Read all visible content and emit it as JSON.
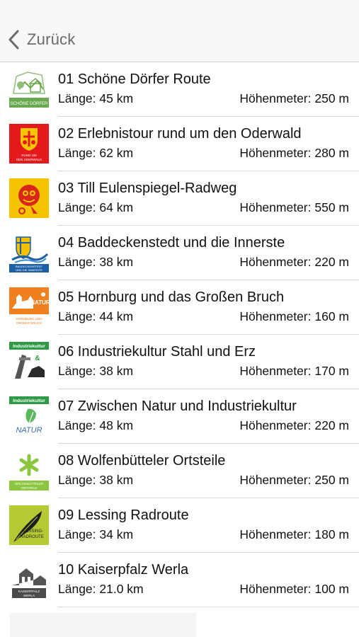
{
  "nav": {
    "back_label": "Zurück",
    "back_icon": "chevron-left-icon",
    "tint": "#6b6b6b"
  },
  "routes": [
    {
      "title": "01 Schöne Dörfer Route",
      "length": "Länge: 45 km",
      "elevation": "Höhenmeter: 250 m",
      "logo_text": "SCHÖNE DÖRFER",
      "logo_color": "#6aa84f"
    },
    {
      "title": "02 Erlebnistour rund um den Oderwald",
      "length": "Länge: 62 km",
      "elevation": "Höhenmeter: 280 m",
      "logo_text": "RUND UM DEN ODERWALD",
      "logo_color": "#e3191b"
    },
    {
      "title": "03 Till Eulenspiegel-Radweg",
      "length": "Länge: 64 km",
      "elevation": "Höhenmeter: 550 m",
      "logo_text": "",
      "logo_color": "#f5c400"
    },
    {
      "title": "04 Baddeckenstedt und die Innerste",
      "length": "Länge: 38 km",
      "elevation": "Höhenmeter: 220 m",
      "logo_text": "BADDECKENSTEDT UND DIE INNERSTE",
      "logo_color": "#1d5fa6"
    },
    {
      "title": "05 Hornburg und das Großen Bruch",
      "length": "Länge: 44 km",
      "elevation": "Höhenmeter: 160 m",
      "logo_text": "HORNBURG UND GROßES BRUCH",
      "logo_color": "#f07f1e"
    },
    {
      "title": "06 Industriekultur Stahl und Erz",
      "length": "Länge: 38 km",
      "elevation": "Höhenmeter: 170 m",
      "logo_text": "Industriekultur",
      "logo_color": "#2d9a46"
    },
    {
      "title": "07 Zwischen Natur und Industriekultur",
      "length": "Länge: 48 km",
      "elevation": "Höhenmeter: 220 m",
      "logo_text": "Industriekultur",
      "logo_text_2": "NATUR",
      "logo_color": "#2d9a46"
    },
    {
      "title": "08 Wolfenbütteler Ortsteile",
      "length": "Länge: 38 km",
      "elevation": "Höhenmeter: 250 m",
      "logo_text": "WOLFENBÜTTELER ORTSTEILE",
      "logo_color": "#8cc63f"
    },
    {
      "title": "09 Lessing Radroute",
      "length": "Länge: 34 km",
      "elevation": "Höhenmeter: 180 m",
      "logo_text": "LESSING-RADROUTE",
      "logo_color": "#b5c934"
    },
    {
      "title": "10 Kaiserpfalz Werla",
      "length": "Länge: 21.0 km",
      "elevation": "Höhenmeter: 100 m",
      "logo_text": "KAISERPFALZ WERLA",
      "logo_color": "#4a4a4a"
    }
  ]
}
